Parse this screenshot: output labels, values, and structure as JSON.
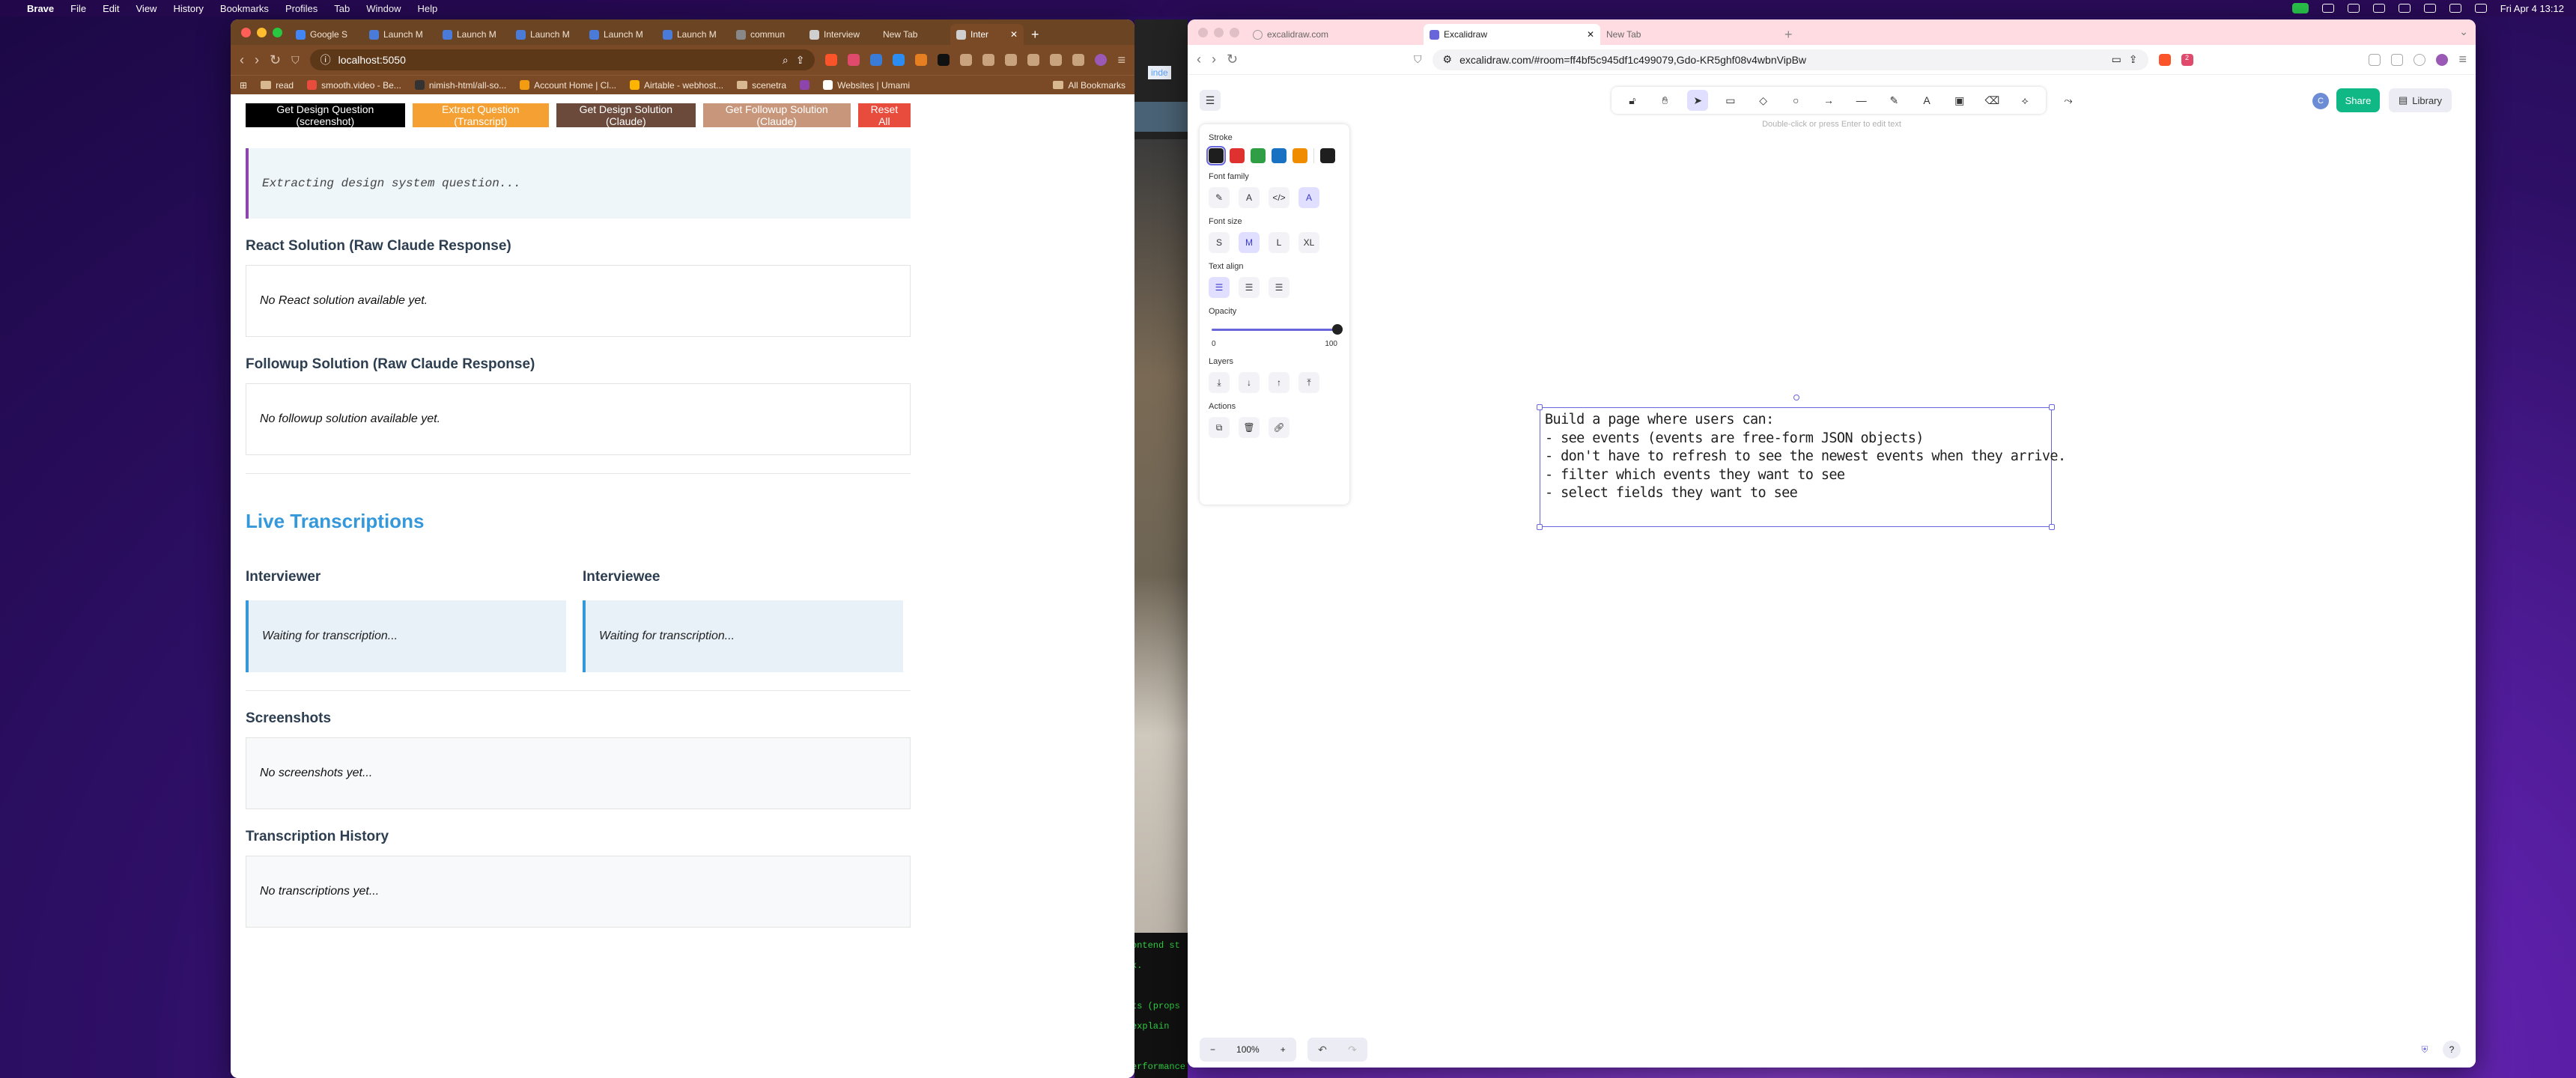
{
  "menubar": {
    "app": "Brave",
    "items": [
      "File",
      "Edit",
      "View",
      "History",
      "Bookmarks",
      "Profiles",
      "Tab",
      "Window",
      "Help"
    ],
    "datetime": "Fri Apr 4  13:12"
  },
  "left_browser": {
    "tabs": [
      {
        "label": "Google S",
        "color": "#4285f4"
      },
      {
        "label": "Launch M",
        "color": "#4a7bd8"
      },
      {
        "label": "Launch M",
        "color": "#4a7bd8"
      },
      {
        "label": "Launch M",
        "color": "#4a7bd8"
      },
      {
        "label": "Launch M",
        "color": "#4a7bd8"
      },
      {
        "label": "Launch M",
        "color": "#4a7bd8"
      },
      {
        "label": "commun",
        "color": "#888888"
      },
      {
        "label": "Interview",
        "color": "#cfcfcf"
      },
      {
        "label": "New Tab",
        "color": "#cfcfcf"
      },
      {
        "label": "Inter",
        "color": "#cfcfcf"
      }
    ],
    "url": "localhost:5050",
    "bookmarks": [
      "read",
      "smooth.video - Be...",
      "nimish-html/all-so...",
      "Account Home | Cl...",
      "Airtable - webhost...",
      "scenetra",
      "Websites | Umami",
      "All Bookmarks"
    ]
  },
  "app": {
    "buttons": {
      "screenshot": "Get Design Question (screenshot)",
      "transcript": "Extract Question (Transcript)",
      "design": "Get Design Solution (Claude)",
      "followup": "Get Followup Solution (Claude)",
      "reset": "Reset All"
    },
    "extracting": "Extracting design system question...",
    "react_heading": "React Solution (Raw Claude Response)",
    "react_empty": "No React solution available yet.",
    "followup_heading": "Followup Solution (Raw Claude Response)",
    "followup_empty": "No followup solution available yet.",
    "live_heading": "Live Transcriptions",
    "interviewer": {
      "heading": "Interviewer",
      "text": "Waiting for transcription..."
    },
    "interviewee": {
      "heading": "Interviewee",
      "text": "Waiting for transcription..."
    },
    "screenshots_heading": "Screenshots",
    "screenshots_empty": "No screenshots yet...",
    "history_heading": "Transcription History",
    "history_empty": "No transcriptions yet..."
  },
  "background_window": {
    "tab_fragment": "inde",
    "code_lines": [
      "ontend st",
      "k.",
      "",
      "ts (props",
      "explain",
      "",
      "erformance"
    ]
  },
  "right_browser": {
    "tabs": [
      {
        "label": "excalidraw.com"
      },
      {
        "label": "Excalidraw"
      },
      {
        "label": "New Tab"
      }
    ],
    "url": "excalidraw.com/#room=ff4bf5c945df1c499079,Gdo-KR5ghf08v4wbnVipBw",
    "brave_badge": "2"
  },
  "excalidraw": {
    "hint": "Double-click or press Enter to edit text",
    "avatar_initial": "C",
    "share_label": "Share",
    "library_label": "Library",
    "stroke_label": "Stroke",
    "stroke_colors": [
      "#1e1e1e",
      "#e03131",
      "#2f9e44",
      "#1971c2",
      "#f08c00"
    ],
    "current_stroke": "#1e1e1e",
    "font_family_label": "Font family",
    "font_size_label": "Font size",
    "font_sizes": [
      "S",
      "M",
      "L",
      "XL"
    ],
    "selected_font_size": "M",
    "text_align_label": "Text align",
    "opacity_label": "Opacity",
    "opacity_value": 100,
    "opacity_min": "0",
    "opacity_max": "100",
    "layers_label": "Layers",
    "actions_label": "Actions",
    "text": "Build a page where users can:\n- see events (events are free-form JSON objects)\n- don't have to refresh to see the newest events when they arrive.\n- filter which events they want to see\n- select fields they want to see",
    "zoom": "100%"
  }
}
